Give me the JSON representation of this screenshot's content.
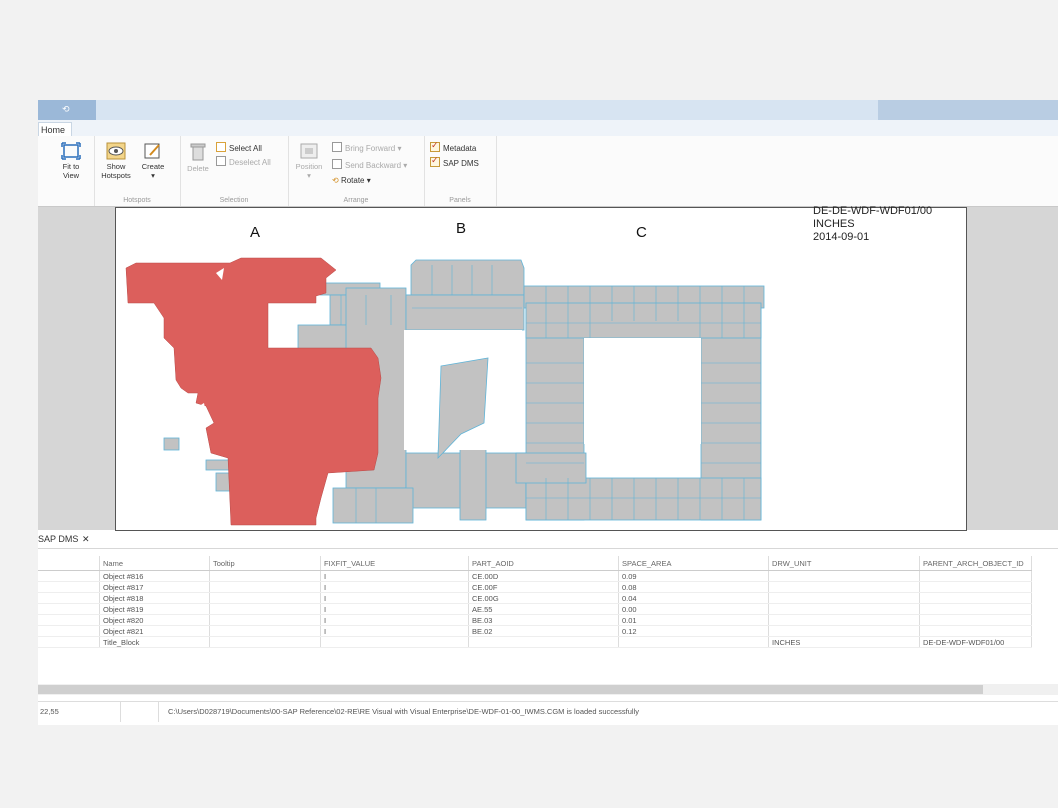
{
  "app": {
    "tab_home": "Home"
  },
  "ribbon": {
    "fit_to_view": "Fit to\nView",
    "show_hotspots": "Show\nHotspots",
    "create": "Create",
    "hotspots_group": "Hotspots",
    "delete": "Delete",
    "select_all": "Select All",
    "deselect_all": "Deselect All",
    "selection_group": "Selection",
    "position": "Position",
    "bring_forward": "Bring Forward",
    "send_backward": "Send Backward",
    "rotate": "Rotate",
    "arrange_group": "Arrange",
    "metadata": "Metadata",
    "sap_dms": "SAP DMS",
    "panels_group": "Panels"
  },
  "drawing": {
    "label_a": "A",
    "label_b": "B",
    "label_c": "C",
    "title_block": [
      "DE-DE-WDF-WDF01/00",
      "INCHES",
      "2014-09-01"
    ],
    "colors": {
      "room": "#c2c2c2",
      "selected": "#dc5f5c",
      "outline": "#5fb4d8"
    }
  },
  "panel": {
    "tab_label": "SAP DMS",
    "close": "✕"
  },
  "table": {
    "headers": [
      "Name",
      "Tooltip",
      "FIXFIT_VALUE",
      "PART_AOID",
      "SPACE_AREA",
      "DRW_UNIT",
      "PARENT_ARCH_OBJECT_ID"
    ],
    "rows": [
      [
        "Object #816",
        "",
        "I",
        "CE.00D",
        "0.09",
        "",
        ""
      ],
      [
        "Object #817",
        "",
        "I",
        "CE.00F",
        "0.08",
        "",
        ""
      ],
      [
        "Object #818",
        "",
        "I",
        "CE.00G",
        "0.04",
        "",
        ""
      ],
      [
        "Object #819",
        "",
        "I",
        "AE.55",
        "0.00",
        "",
        ""
      ],
      [
        "Object #820",
        "",
        "I",
        "BE.03",
        "0.01",
        "",
        ""
      ],
      [
        "Object #821",
        "",
        "I",
        "BE.02",
        "0.12",
        "",
        ""
      ],
      [
        "Title_Block",
        "",
        "",
        "",
        "",
        "INCHES",
        "DE-DE-WDF-WDF01/00"
      ]
    ]
  },
  "status": {
    "coords": "22,55",
    "message": "C:\\Users\\D028719\\Documents\\00-SAP Reference\\02-RE\\RE Visual with Visual Enterprise\\DE-WDF-01-00_IWMS.CGM is loaded successfully"
  }
}
